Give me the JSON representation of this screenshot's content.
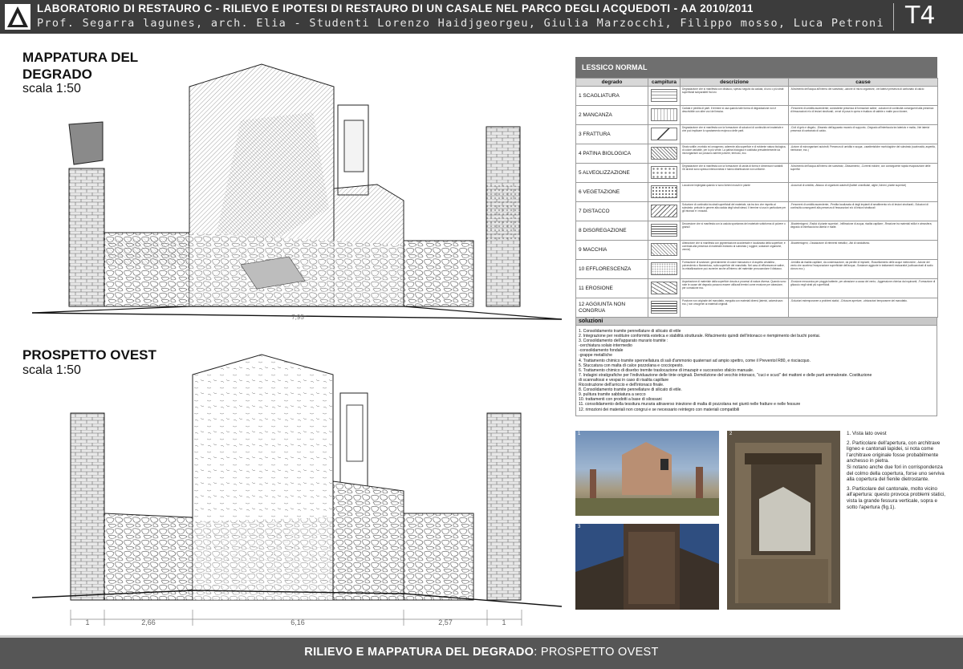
{
  "header": {
    "line1": "LABORATORIO DI RESTAURO C - RILIEVO E IPOTESI DI RESTAURO DI UN CASALE NEL PARCO DEGLI ACQUEDOTI - AA 2010/2011",
    "line2": "Prof. Segarra lagunes, arch. Elia - Studenti Lorenzo Haidjgeorgeu, Giulia Marzocchi, Filippo mosso, Luca Petroni",
    "code": "T4"
  },
  "mappatura": {
    "title_l1": "MAPPATURA DEL",
    "title_l2": "DEGRADO",
    "scale": "scala 1:50"
  },
  "prospetto": {
    "title": "PROSPETTO OVEST",
    "scale": "scala 1:50",
    "top_dim": "7,95",
    "dims": [
      "1",
      "2,66",
      "6,16",
      "2,57",
      "1"
    ]
  },
  "lessico": {
    "title": "LESSICO NORMAL",
    "columns": [
      "degrado",
      "campitura",
      "descrizione",
      "cause"
    ],
    "rows": [
      {
        "name": "1 SCAGLIATURA",
        "pattern": "scagliatura",
        "desc": "Degradazione che si manifesta con distacco, spesso seguito da caduta, di uno o più strati superficiali subparalleli fra loro",
        "cause": "-Movimento dell'acqua all'interno del substrato; -azione di micro organismi; -nei laterizi presenza di carbonato di calcio"
      },
      {
        "name": "2 MANCANZA",
        "pattern": "mancanza",
        "desc": "Caduta e perdita di parti. Il termine si usa quando tale forma di degradazione non è descrivibile con altre voci del lessico.",
        "cause": "-Fenomeni di umidità ascendente; consistente presenza di formazioni saline; -soluzioni di continuità conseguenti alla presenza di fessurazioni e/o di lesioni strutturali; -errori di posa in opera e risalizzo di sabbie o malte poco idonee;"
      },
      {
        "name": "3 FRATTURA",
        "pattern": "frattura",
        "desc": "Degradazione che si manifesta con la formazione di soluzioni di continuità nel materiale e che può implicare lo spostamento reciproco delle parti.",
        "cause": "-Cicli di gelo e disgelo; -Dissesto dell'apparato murario di supporto; -Degrado all'interfaccia tra laterizio e malta; -Nei laterizi presenza di carbonato di calcio."
      },
      {
        "name": "4 PATINA BIOLOGICA",
        "pattern": "patina",
        "desc": "Strato sottile, morbido ed omogeneo, aderente alla superficie e di evidente natura biologica, di colore variabile, per lo più verde. La patina biologica è costituita prevalentemente da microrganismi cui possono aderire polvere, terriccio, ecc.",
        "cause": "-Azione di microrganismi autotrofi; Presenza di umidità e acqua; -caratteristiche morfologiche del substrato (scabrosità, asperità, rientranze, ecc.)"
      },
      {
        "name": "5 ALVEOLIZZAZIONE",
        "pattern": "alveoli",
        "desc": "Degradazione che si manifesta con la formazione di cavità di forma e dimensioni variabili. Gli alveoli sono spesso interconnessi e hanno distribuzione non uniforme.",
        "cause": "-Movimento dell'acqua all'interno del substrato; -Dilavamento; -Correnti eoliche, con conseguente rapida evaporazione delle superfici"
      },
      {
        "name": "6 VEGETAZIONE",
        "pattern": "vegetazione",
        "desc": "Locuzione impiegata quando vi sono licheni muschi e piante",
        "cause": "-Accumuli di umidità; -Attacco di organismi autotrofi (batteri unicellulari, alghe, licheni, piante superiori)"
      },
      {
        "name": "7 DISTACCO",
        "pattern": "distacco",
        "desc": "Soluzione di continuità tra strati superficiali del materiale, sia tra loro che rispetto al substrato: prelude in genere alla caduta degli strati stessi. Il termine si usa in particolare per gli intonaci e i mosaici.",
        "cause": "-Fenomeni di umidità ascendente; -Perdita localizzata di degli impianti di smaltimento e/o di lesioni strutturali; -Soluzioni di continuità conseguenti alla presenza di fessurazioni e/o di lesioni strutturali"
      },
      {
        "name": "8 DISGREGAZIONE",
        "pattern": "disgregazione",
        "desc": "Decoesione che si manifesta con la caduta spontanea del materiale sottoforma di polvere o granuli",
        "cause": "-Biodeteriogeni; -Radici di piante superiori; -Infiltrazione di acqua, risalita capillare; -Reazione tra materiali edilizi e atmosfera; degrado di interfaccia tra laterizi e malte."
      },
      {
        "name": "9 MACCHIA",
        "pattern": "macchia",
        "desc": "Alterazione che si manifesta con pigmentazione accidentale e localizzata della superficie; è correlata alla presenza di materiale estraneo al substrato ( ruggine, sostanze organiche, vernici)",
        "cause": "-Biodeteriogeni; -Ossidazione di elementi metallici; -Atti di vandalismo."
      },
      {
        "name": "10 EFFLORESCENZA",
        "pattern": "efflorescenza",
        "desc": "Formazione di sostanze, generalmente di colore biancastro e di aspetto cristallino , pulverulento o filamentoso, sulla superficie del manufatto. Nel caso di efflorescenze saline, la cristallizzazione può avvenire anche all'interno del materiale provocandone il distacco.",
        "cause": "-Umidità da risalita capillare, da condensazione, da perdite di impianti; -Ruscellamento delle acque meteoriche; -Azione del vento che accelera l'evaporazione superficiale dell'acqua; -Sostanze aggiunte in trattamenti restaurativi (solfocarcinati di sodio cloruro ecc.)"
      },
      {
        "name": "11 EROSIONE",
        "pattern": "erosione",
        "desc": "Asportazione di materiale dalla superficie dovuta a processi di natura diversa. Quando sono note le cause del degrado possono essere utilizzati termini come erosione per abrasione, per corrasione ecc.",
        "cause": "-Erosione meccanica per pioggia battente, per abrasione a causa del vento; -Aggressione chimica da inquinanti; -Formazione di ghiaccio negli strati più superficiali."
      },
      {
        "name": "12 AGGIUNTA NON CONGRUA",
        "pattern": "aggiunta",
        "desc": "Porzione non originale del manufatto, eseguita con materiali diversi (laterizi, calcestruzzo ecc.) non omogenei ai materiali originali.",
        "cause": "-Soluzioni estemporanee a problemi statici; -Chiusure aperture; -obturazioni temporanee del manufatto."
      }
    ]
  },
  "soluzioni": {
    "title": "soluzioni",
    "items": [
      "1. Consolidamento tramite pennellature di silicato di etile",
      "2. Integrazione per restituire conformità estetica e stabilità strutturale. Rifacimento quindi dell'intonaco e riempimento dei buchi pontai.",
      "3. Consolidamento dell'apparato murario tramite :",
      "-cerchiatura solaio intermedio",
      "-consolidamento fondale",
      "-grappe metalliche",
      "4. Trattamento chimico tramite spennellatura di sali d'ammonio quaternari ad ampio spettro, come il Preventol R80, e risciacquo.",
      "5. Stuccatura con malta di calce pozzolana e cocciopesto.",
      "6. Trattamento chimico di diserbo tremite traslocazione di imazapir e successivo sfalcio manuale.",
      "7. Indagini stratigrafiche per l'individuazione delle tinte originali. Demolizione del vecchio intonaco, \"cuci e scuci\" dei mattoni e delle parti ammalorate. Costituzione",
      "di scannafossi e vespai in caso di risalita capillare",
      "Ricostruzione dell'arriccio e dell'intonaco finale.",
      "8. Consolidamento tramite pennellature di silicato di etile.",
      "9. pulitura tramite sabbiatura a secco",
      "10. trattamenti con prodotti a base di silossani",
      "11. consolidamento della tessitura muraria attraverso iniezione di malta di pozzolana nei giunti nelle fratture e nelle fessure",
      "12. rimozioni dei materiali non congrui e se necessario reintegro con materiali compatibili"
    ]
  },
  "photos": [
    {
      "num": "1"
    },
    {
      "num": "2"
    },
    {
      "num": "3"
    }
  ],
  "captions": [
    "1. Vista lato ovest",
    "2. Particolare dell'apertura, con architrave ligneo e cantonali lapidei, si nota come l'architrave originale fosse probabilmente anchesso in pietra.\nSi notano anche due fori in corrispondenza del colmo della copertura, forse uno serviva alla copertura del fienile dietrostante.",
    "3. Particolare del cantonale, molto vicino all'apertura: questo provoca problemi statici, vista la grande fessura verticale, sopra e sotto l'apertura (fig.1)."
  ],
  "footer": {
    "bold": "RILIEVO E MAPPATURA DEL DEGRADO",
    "rest": ": PROSPETTO OVEST"
  },
  "colors": {
    "header_bg": "#3c3c3c",
    "footer_bg": "#565656",
    "table_head": "#6f6f6f"
  }
}
